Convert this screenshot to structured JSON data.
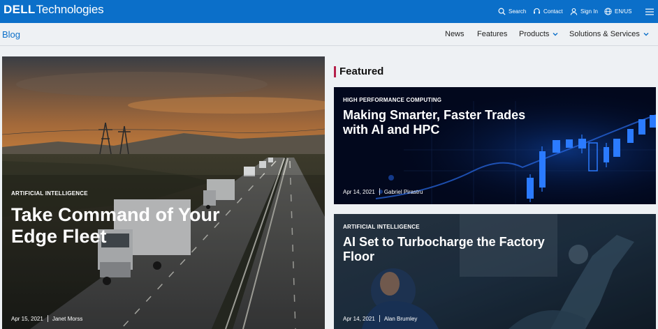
{
  "header": {
    "logo_brand": "DELL",
    "logo_suffix": "Technologies",
    "search_label": "Search",
    "contact_label": "Contact",
    "signin_label": "Sign In",
    "language_label": "EN/US"
  },
  "subnav": {
    "blog_label": "Blog",
    "items": [
      {
        "label": "News"
      },
      {
        "label": "Features"
      },
      {
        "label": "Products"
      },
      {
        "label": "Solutions & Services"
      }
    ]
  },
  "hero": {
    "category": "ARTIFICIAL INTELLIGENCE",
    "title": "Take Command of Your Edge Fleet",
    "date": "Apr 15, 2021",
    "author": "Janet Morss"
  },
  "featured": {
    "heading": "Featured",
    "cards": [
      {
        "category": "HIGH PERFORMANCE COMPUTING",
        "title": "Making Smarter, Faster Trades with AI and HPC",
        "date": "Apr 14, 2021",
        "author": "Gabriel Pirastru"
      },
      {
        "category": "ARTIFICIAL INTELLIGENCE",
        "title": "AI Set to Turbocharge the Factory Floor",
        "date": "Apr 14, 2021",
        "author": "Alan Brumley"
      }
    ]
  },
  "colors": {
    "brand_blue": "#0b6fc9",
    "featured_accent": "#b5204a"
  }
}
